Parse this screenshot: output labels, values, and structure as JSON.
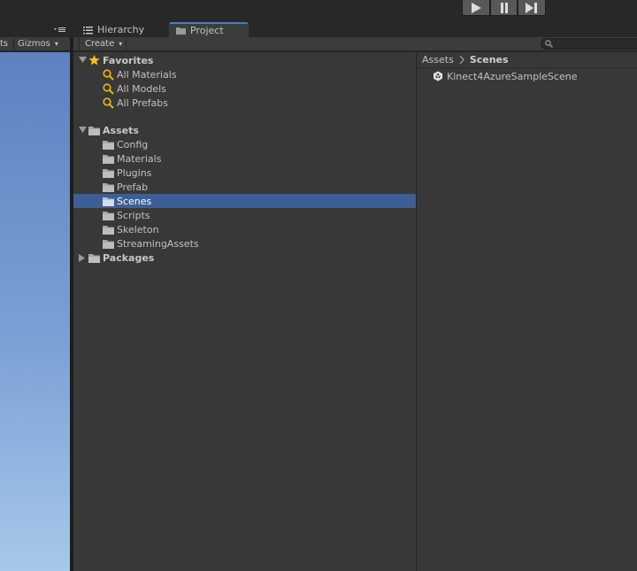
{
  "colors": {
    "selection": "#3e5f96",
    "tab_accent": "#4a7fb8",
    "panel_bg": "#383838",
    "toolbar_bg": "#3c3c3c",
    "favorite_star": "#f5c518",
    "search_icon": "#e8b911"
  },
  "playbar": {
    "play_icon": "play-icon",
    "pause_icon": "pause-icon",
    "step_icon": "step-icon"
  },
  "tabs": {
    "hierarchy_label": "Hierarchy",
    "project_label": "Project"
  },
  "scene_toolbar": {
    "truncated_label": "ts",
    "gizmos_label": "Gizmos",
    "dropdown_caret": "▾"
  },
  "project_toolbar": {
    "create_label": "Create",
    "create_caret": "▾",
    "search_value": ""
  },
  "tree": {
    "favorites": {
      "label": "Favorites",
      "items": [
        {
          "label": "All Materials"
        },
        {
          "label": "All Models"
        },
        {
          "label": "All Prefabs"
        }
      ]
    },
    "assets": {
      "label": "Assets",
      "items": [
        {
          "label": "Config"
        },
        {
          "label": "Materials"
        },
        {
          "label": "Plugins"
        },
        {
          "label": "Prefab"
        },
        {
          "label": "Scenes",
          "selected": true
        },
        {
          "label": "Scripts"
        },
        {
          "label": "Skeleton"
        },
        {
          "label": "StreamingAssets"
        }
      ]
    },
    "packages": {
      "label": "Packages"
    }
  },
  "assets_view": {
    "breadcrumb": [
      "Assets",
      "Scenes"
    ],
    "items": [
      {
        "label": "Kinect4AzureSampleScene",
        "icon": "unity-scene-icon"
      }
    ]
  }
}
